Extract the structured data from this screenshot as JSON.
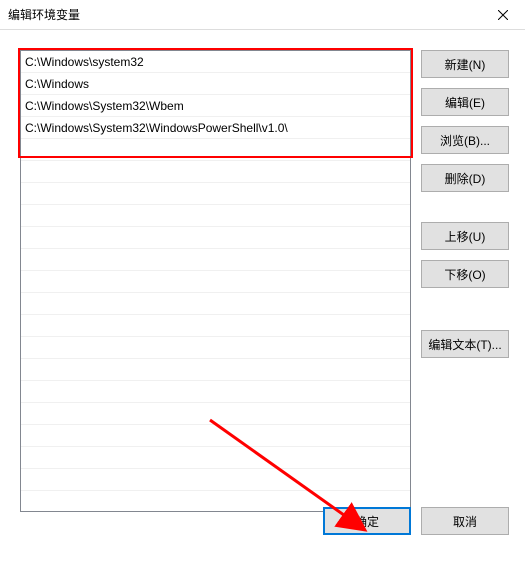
{
  "window": {
    "title": "编辑环境变量"
  },
  "paths": [
    "C:\\Windows\\system32",
    "C:\\Windows",
    "C:\\Windows\\System32\\Wbem",
    "C:\\Windows\\System32\\WindowsPowerShell\\v1.0\\"
  ],
  "buttons": {
    "new": "新建(N)",
    "edit": "编辑(E)",
    "browse": "浏览(B)...",
    "delete": "删除(D)",
    "moveUp": "上移(U)",
    "moveDown": "下移(O)",
    "editText": "编辑文本(T)...",
    "ok": "确定",
    "cancel": "取消"
  }
}
